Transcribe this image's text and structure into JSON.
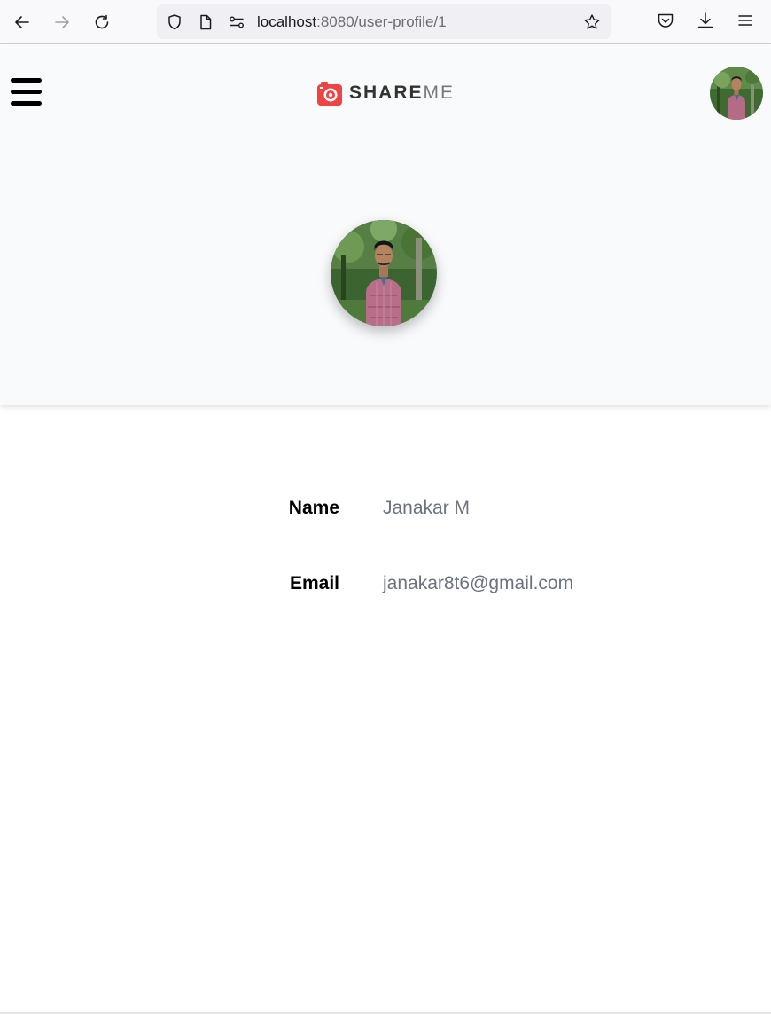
{
  "browser": {
    "url_host": "localhost",
    "url_path": ":8080/user-profile/1"
  },
  "header": {
    "logo_text_bold": "SHARE",
    "logo_text_light": "ME"
  },
  "profile": {
    "name_label": "Name",
    "name_value": "Janakar M",
    "email_label": "Email",
    "email_value": "janakar8t6@gmail.com"
  },
  "colors": {
    "logo_red": "#ef4444",
    "value_gray": "#6b7280",
    "header_bg": "#f9fafb"
  }
}
